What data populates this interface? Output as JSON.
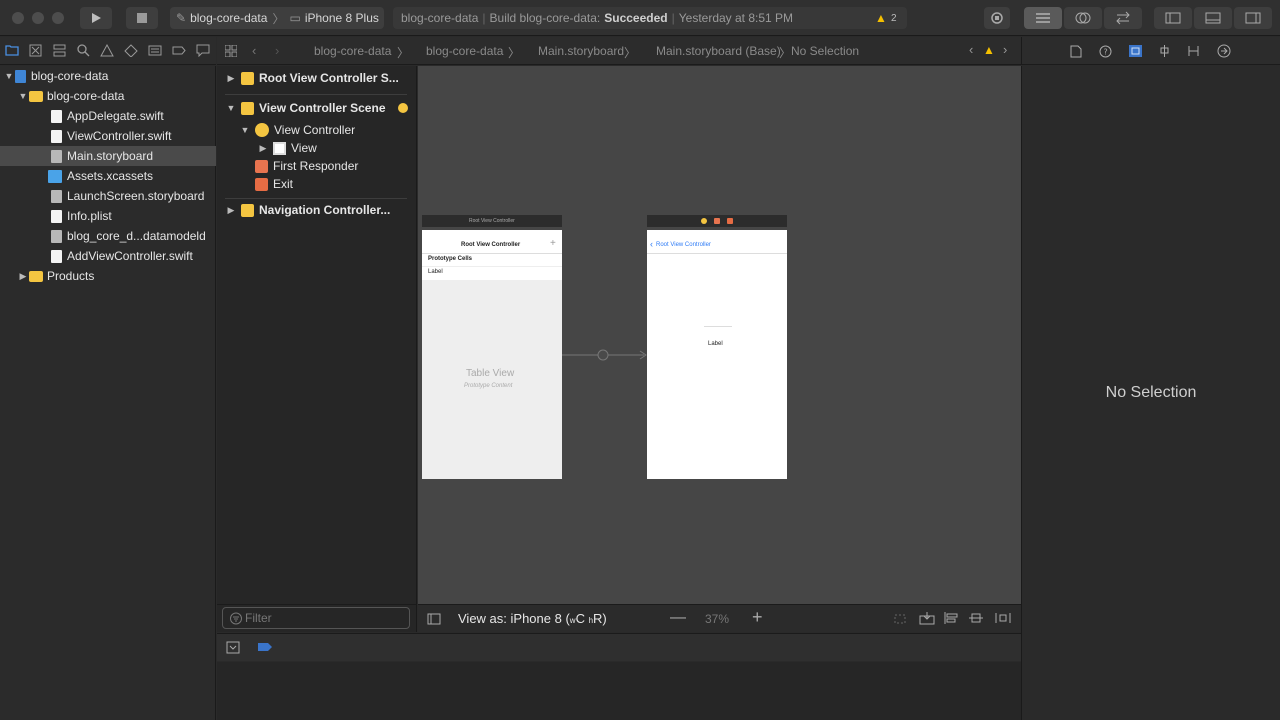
{
  "toolbar": {
    "scheme": "blog-core-data",
    "device": "iPhone 8 Plus",
    "status_project": "blog-core-data",
    "status_build_label": "Build blog-core-data:",
    "status_result": "Succeeded",
    "status_time": "Yesterday at 8:51 PM",
    "warning_count": "2"
  },
  "navigator": {
    "items": [
      {
        "label": "blog-core-data"
      },
      {
        "label": "blog-core-data"
      },
      {
        "label": "AppDelegate.swift"
      },
      {
        "label": "ViewController.swift"
      },
      {
        "label": "Main.storyboard"
      },
      {
        "label": "Assets.xcassets"
      },
      {
        "label": "LaunchScreen.storyboard"
      },
      {
        "label": "Info.plist"
      },
      {
        "label": "blog_core_d...datamodeld"
      },
      {
        "label": "AddViewController.swift"
      },
      {
        "label": "Products"
      }
    ]
  },
  "breadcrumb": {
    "items": [
      "blog-core-data",
      "blog-core-data",
      "Main.storyboard",
      "Main.storyboard (Base)",
      "No Selection"
    ]
  },
  "outline": {
    "scene1": "Root View Controller S...",
    "scene2": "View Controller Scene",
    "vc": "View Controller",
    "view": "View",
    "first_responder": "First Responder",
    "exit": "Exit",
    "scene3": "Navigation Controller..."
  },
  "canvas": {
    "scene1_header": "Root View Controller",
    "scene1_title": "Root View Controller",
    "prototype_cells": "Prototype Cells",
    "cell_label": "Label",
    "table_view": "Table View",
    "prototype_content": "Prototype Content",
    "scene2_back": "Root View Controller",
    "scene2_label": "Label"
  },
  "bottom": {
    "filter_placeholder": "Filter",
    "view_as": "View as: iPhone 8 (",
    "wc": "w",
    "c": "C",
    "hr": "h",
    "r": "R)",
    "zoom": "37%"
  },
  "inspector": {
    "no_selection": "No Selection"
  }
}
